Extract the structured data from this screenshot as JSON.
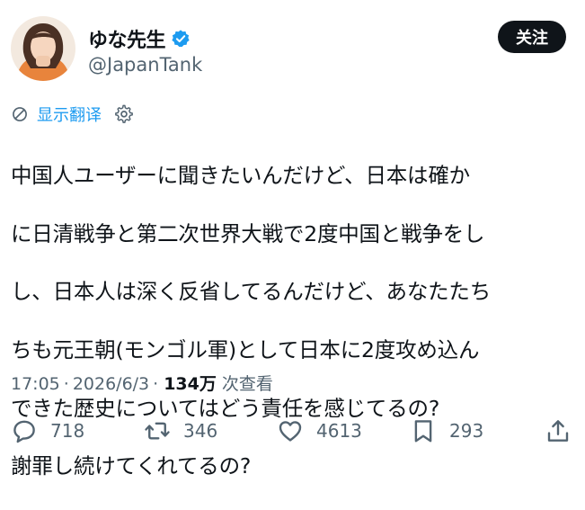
{
  "author": {
    "display_name": "ゆな先生",
    "handle": "@JapanTank",
    "verified": true
  },
  "follow_button_label": "关注",
  "translate": {
    "label": "显示翻译"
  },
  "tweet": {
    "text": "中国人ユーザーに聞きたいんだけど、日本は確か\nに日清戦争と第二次世界大戦で2度中国と戦争をし\nし、日本人は深く反省してるんだけど、あなたたち\nちも元王朝(モンゴル軍)として日本に2度攻め込ん\nできた歴史についてはどう責任を感じてるの?\n謝罪し続けてくれてるの?",
    "lines": [
      "中国人ユーザーに聞きたいんだけど、日本は確か",
      "に日清戦争と第二次世界大戦で2度中国と戦争をし",
      "し、日本人は深く反省してるんだけど、あなたたち",
      "ちも元王朝(モンゴル軍)として日本に2度攻め込ん",
      "できた歴史についてはどう責任を感じてるの?",
      "謝罪し続けてくれてるの?"
    ]
  },
  "meta": {
    "time": "17:05",
    "date": "2026/6/3",
    "separator": "·",
    "views": "134万",
    "views_label": "次查看"
  },
  "actions": {
    "replies": "718",
    "reposts": "346",
    "likes": "4613",
    "bookmarks": "293"
  },
  "colors": {
    "accent": "#1d9bf0",
    "text": "#0f1419",
    "muted": "#536471",
    "avatar_bg": "#e8843c"
  },
  "icons": {
    "verified": "verified-badge-icon",
    "translate": "translate-icon",
    "settings": "gear-icon",
    "reply": "reply-icon",
    "repost": "repost-icon",
    "like": "heart-icon",
    "bookmark": "bookmark-icon",
    "share": "share-icon"
  }
}
